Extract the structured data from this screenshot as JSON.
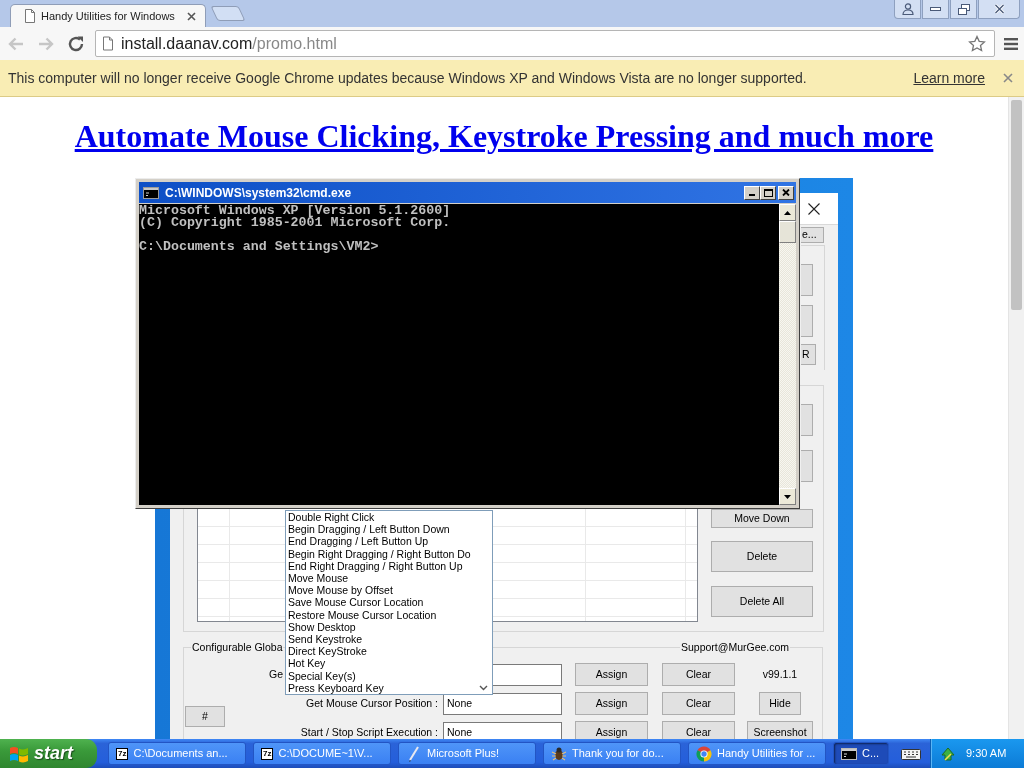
{
  "browser": {
    "tabs": [
      {
        "title": "Handy Utilities for Windows",
        "selected": true
      }
    ],
    "nav_buttons": [
      {
        "kind": "back",
        "disabled": true
      },
      {
        "kind": "forward",
        "disabled": true
      },
      {
        "kind": "reload",
        "disabled": false
      }
    ],
    "address": {
      "host": "install.daanav.com",
      "path": "/promo.html"
    },
    "infobar": {
      "message": "This computer will no longer receive Google Chrome updates because Windows XP and Windows Vista are no longer supported.",
      "link": "Learn more"
    }
  },
  "page": {
    "headline": "Automate Mouse Clicking, Keystroke Pressing and much more",
    "app_screenshot": {
      "cut_off_labels": [
        "e...",
        "R"
      ],
      "list_buttons": [
        "Move Down",
        "Delete",
        "Delete All"
      ],
      "action_menu": [
        "Double Right Click",
        "Begin Dragging / Left Button Down",
        "End Dragging / Left Button Up",
        "Begin Right Dragging / Right Button Do",
        "End Right Dragging / Right Button Up",
        "Move Mouse",
        "Move Mouse by Offset",
        "Save Mouse Cursor Location",
        "Restore Mouse Cursor Location",
        "Show Desktop",
        "Send Keystroke",
        "Direct KeyStroke",
        "Hot Key",
        "Special Key(s)",
        "Press Keyboard Key"
      ],
      "hotkeys": {
        "title": "Configurable Globa",
        "support": "Support@MurGee.com",
        "side_button": "#",
        "rows": [
          {
            "label": "Ge",
            "assign": "Assign",
            "clear": "Clear",
            "extra": {
              "kind": "text",
              "text": "v99.1.1"
            }
          },
          {
            "label": "Get Mouse Cursor Position :",
            "value": "None",
            "assign": "Assign",
            "clear": "Clear",
            "extra": {
              "kind": "button",
              "text": "Hide"
            }
          },
          {
            "label": "Start / Stop Script Execution :",
            "value": "None",
            "assign": "Assign",
            "clear": "Clear",
            "extra": {
              "kind": "button",
              "text": "Screenshot"
            }
          }
        ]
      }
    }
  },
  "console": {
    "title": "C:\\WINDOWS\\system32\\cmd.exe",
    "banner": [
      "Microsoft Windows XP [Version 5.1.2600]",
      "(C) Copyright 1985-2001 Microsoft Corp."
    ],
    "prompt": "C:\\Documents and Settings\\VM2>"
  },
  "taskbar": {
    "start": "start",
    "tasks": [
      {
        "label": "C:\\Documents an...",
        "kind": "archive",
        "icon_text": "7z",
        "selected": false
      },
      {
        "label": "C:\\DOCUME~1\\V...",
        "kind": "archive",
        "icon_text": "7z",
        "selected": false
      },
      {
        "label": "Microsoft Plus!",
        "kind": "pen",
        "selected": false
      },
      {
        "label": "Thank you for do...",
        "kind": "bug",
        "selected": false
      },
      {
        "label": "Handy Utilities for ...",
        "kind": "circle",
        "selected": false
      },
      {
        "label": "C...",
        "kind": "console",
        "selected": true
      }
    ],
    "clock": "9:30 AM"
  }
}
